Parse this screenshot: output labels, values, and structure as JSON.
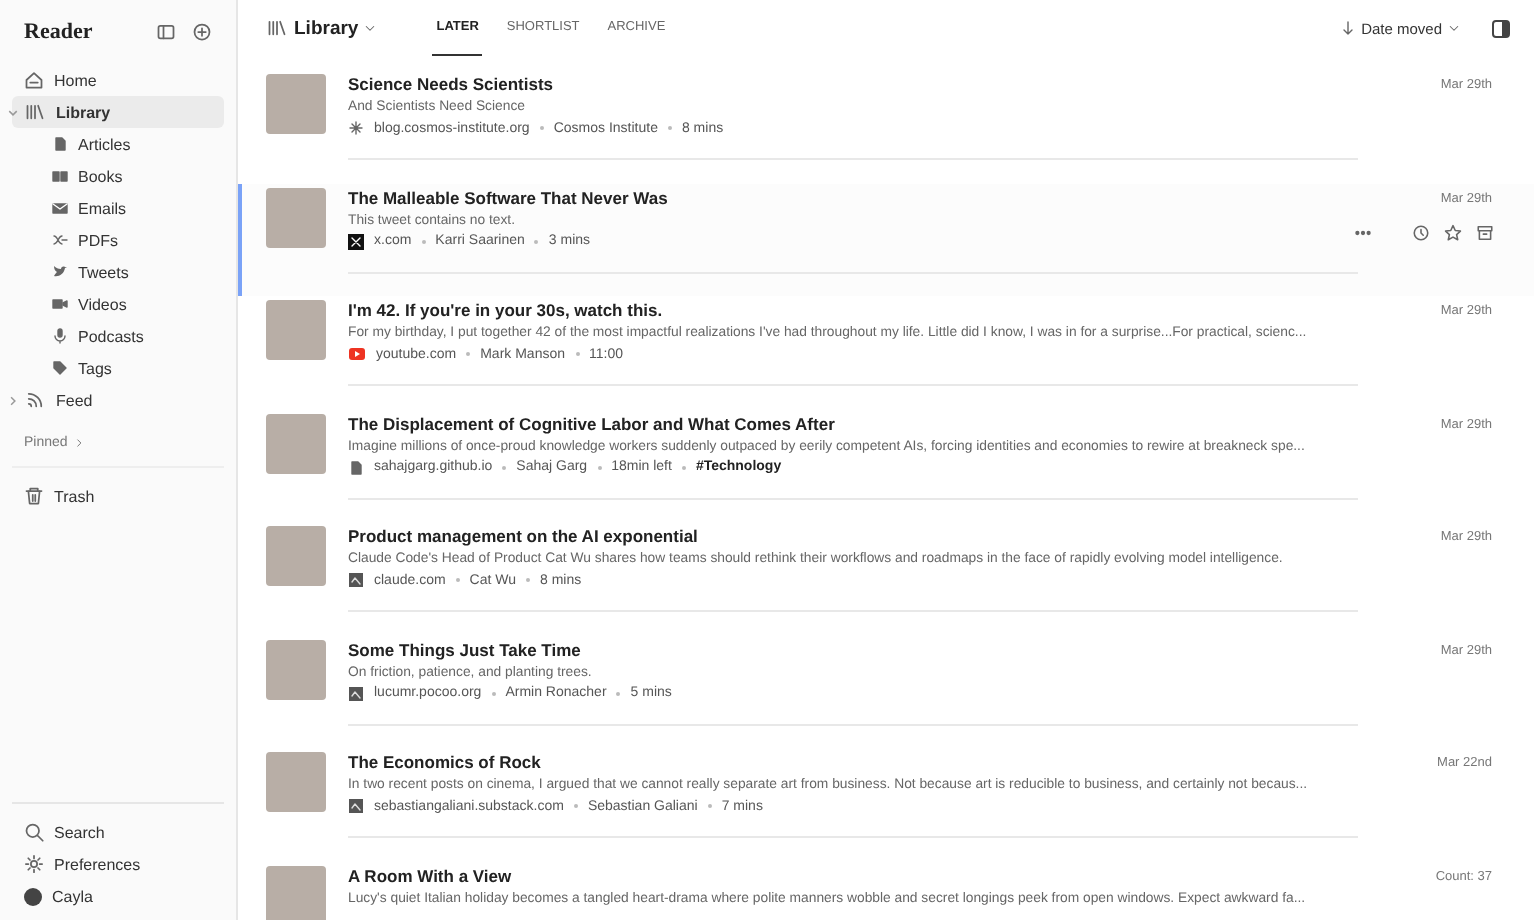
{
  "sidebar": {
    "app_title": "Reader",
    "items": [
      {
        "label": "Home",
        "kind": "home",
        "selected": false
      },
      {
        "label": "Library",
        "kind": "library",
        "selected": true,
        "expanded": true,
        "children": [
          {
            "label": "Articles",
            "kind": "document"
          },
          {
            "label": "Books",
            "kind": "book"
          },
          {
            "label": "Emails",
            "kind": "envelope"
          },
          {
            "label": "PDFs",
            "kind": "pdf"
          },
          {
            "label": "Tweets",
            "kind": "bird"
          },
          {
            "label": "Videos",
            "kind": "video"
          },
          {
            "label": "Podcasts",
            "kind": "microphone"
          },
          {
            "label": "Tags",
            "kind": "tag"
          }
        ]
      },
      {
        "label": "Feed",
        "kind": "rss",
        "selected": false,
        "expanded": false
      }
    ],
    "pinned_label": "Pinned",
    "trash": "Trash",
    "footer": [
      {
        "label": "Search",
        "kind": "search"
      },
      {
        "label": "Preferences",
        "kind": "settings"
      },
      {
        "label": "Cayla",
        "kind": "avatar"
      }
    ]
  },
  "header": {
    "title": "Library",
    "tabs": [
      {
        "label": "LATER",
        "selected": true
      },
      {
        "label": "SHORTLIST",
        "selected": false
      },
      {
        "label": "ARCHIVE",
        "selected": false
      }
    ],
    "sort": "Date moved"
  },
  "rows": [
    {
      "title": "Science Needs Scientists",
      "description": "And Scientists Need Science",
      "kind": "globe",
      "source": "blog.cosmos-institute.org",
      "author": "Cosmos Institute",
      "length": "8 mins",
      "date": "Mar 29th",
      "selected": false
    },
    {
      "title": "The Malleable Software That Never Was",
      "description": "This tweet contains no text.",
      "kind": "x",
      "source": "x.com",
      "author": "Karri Saarinen",
      "length": "3 mins",
      "date": "Mar 29th",
      "selected": true
    },
    {
      "title": "I'm 42. If you're in your 30s, watch this.",
      "description": "For my birthday, I put together 42 of the most impactful realizations I've had throughout my life. Little did I know, I was in for a surprise...For practical, scienc...",
      "kind": "youtube",
      "source": "youtube.com",
      "author": "Mark Manson",
      "length": "11:00",
      "date": "Mar 29th",
      "selected": false
    },
    {
      "title": "The Displacement of Cognitive Labor and What Comes After",
      "description": "Imagine millions of once-proud knowledge workers suddenly outpaced by eerily competent AIs, forcing identities and economies to rewire at breakneck spe...",
      "kind": "document",
      "source": "sahajgarg.github.io",
      "author": "Sahaj Garg",
      "length": "18min left",
      "tag": "#Technology",
      "date": "Mar 29th",
      "selected": false
    },
    {
      "title": "Product management on the AI exponential",
      "description": "Claude Code's Head of Product Cat Wu shares how teams should rethink their workflows and roadmaps in the face of rapidly evolving model intelligence.",
      "kind": "favicon",
      "source": "claude.com",
      "author": "Cat Wu",
      "length": "8 mins",
      "date": "Mar 29th",
      "selected": false
    },
    {
      "title": "Some Things Just Take Time",
      "description": "On friction, patience, and planting trees.",
      "kind": "favicon",
      "source": "lucumr.pocoo.org",
      "author": "Armin Ronacher",
      "length": "5 mins",
      "date": "Mar 29th",
      "selected": false
    },
    {
      "title": "The Economics of Rock",
      "description": "In two recent posts on cinema, I argued that we cannot really separate art from business. Not because art is reducible to business, and certainly not becaus...",
      "kind": "favicon",
      "source": "sebastiangaliani.substack.com",
      "author": "Sebastian Galiani",
      "length": "7 mins",
      "date": "Mar 22nd",
      "selected": false
    },
    {
      "title": "A Room With a View",
      "description": "Lucy's quiet Italian holiday becomes a tangled heart-drama where polite manners wobble and secret longings peek from open windows. Expect awkward fa...",
      "date": "Count: 37",
      "selected": false
    }
  ]
}
